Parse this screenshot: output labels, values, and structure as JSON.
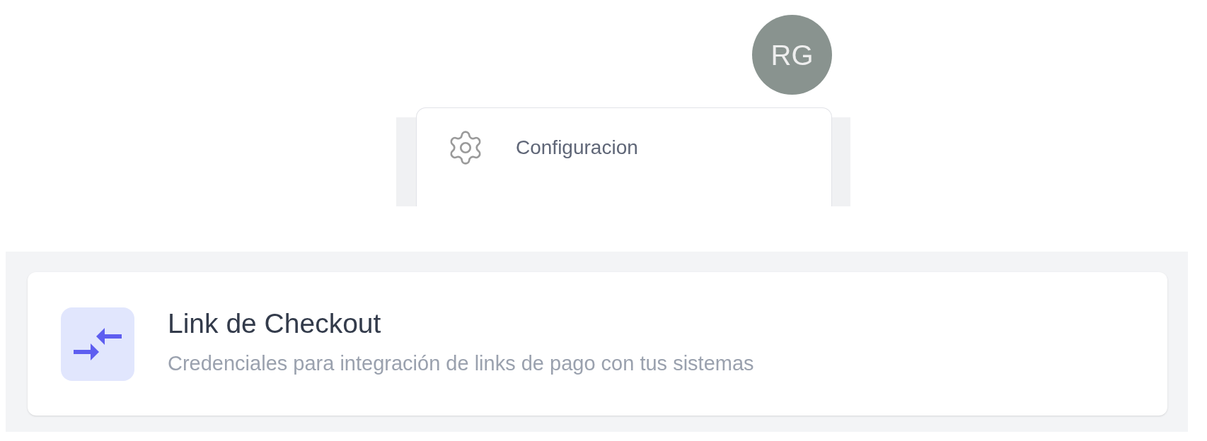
{
  "avatar": {
    "initials": "RG"
  },
  "menu": {
    "items": [
      {
        "label": "Configuracion"
      }
    ]
  },
  "card": {
    "title": "Link de Checkout",
    "description": "Credenciales para integración de links de pago con tus sistemas"
  }
}
